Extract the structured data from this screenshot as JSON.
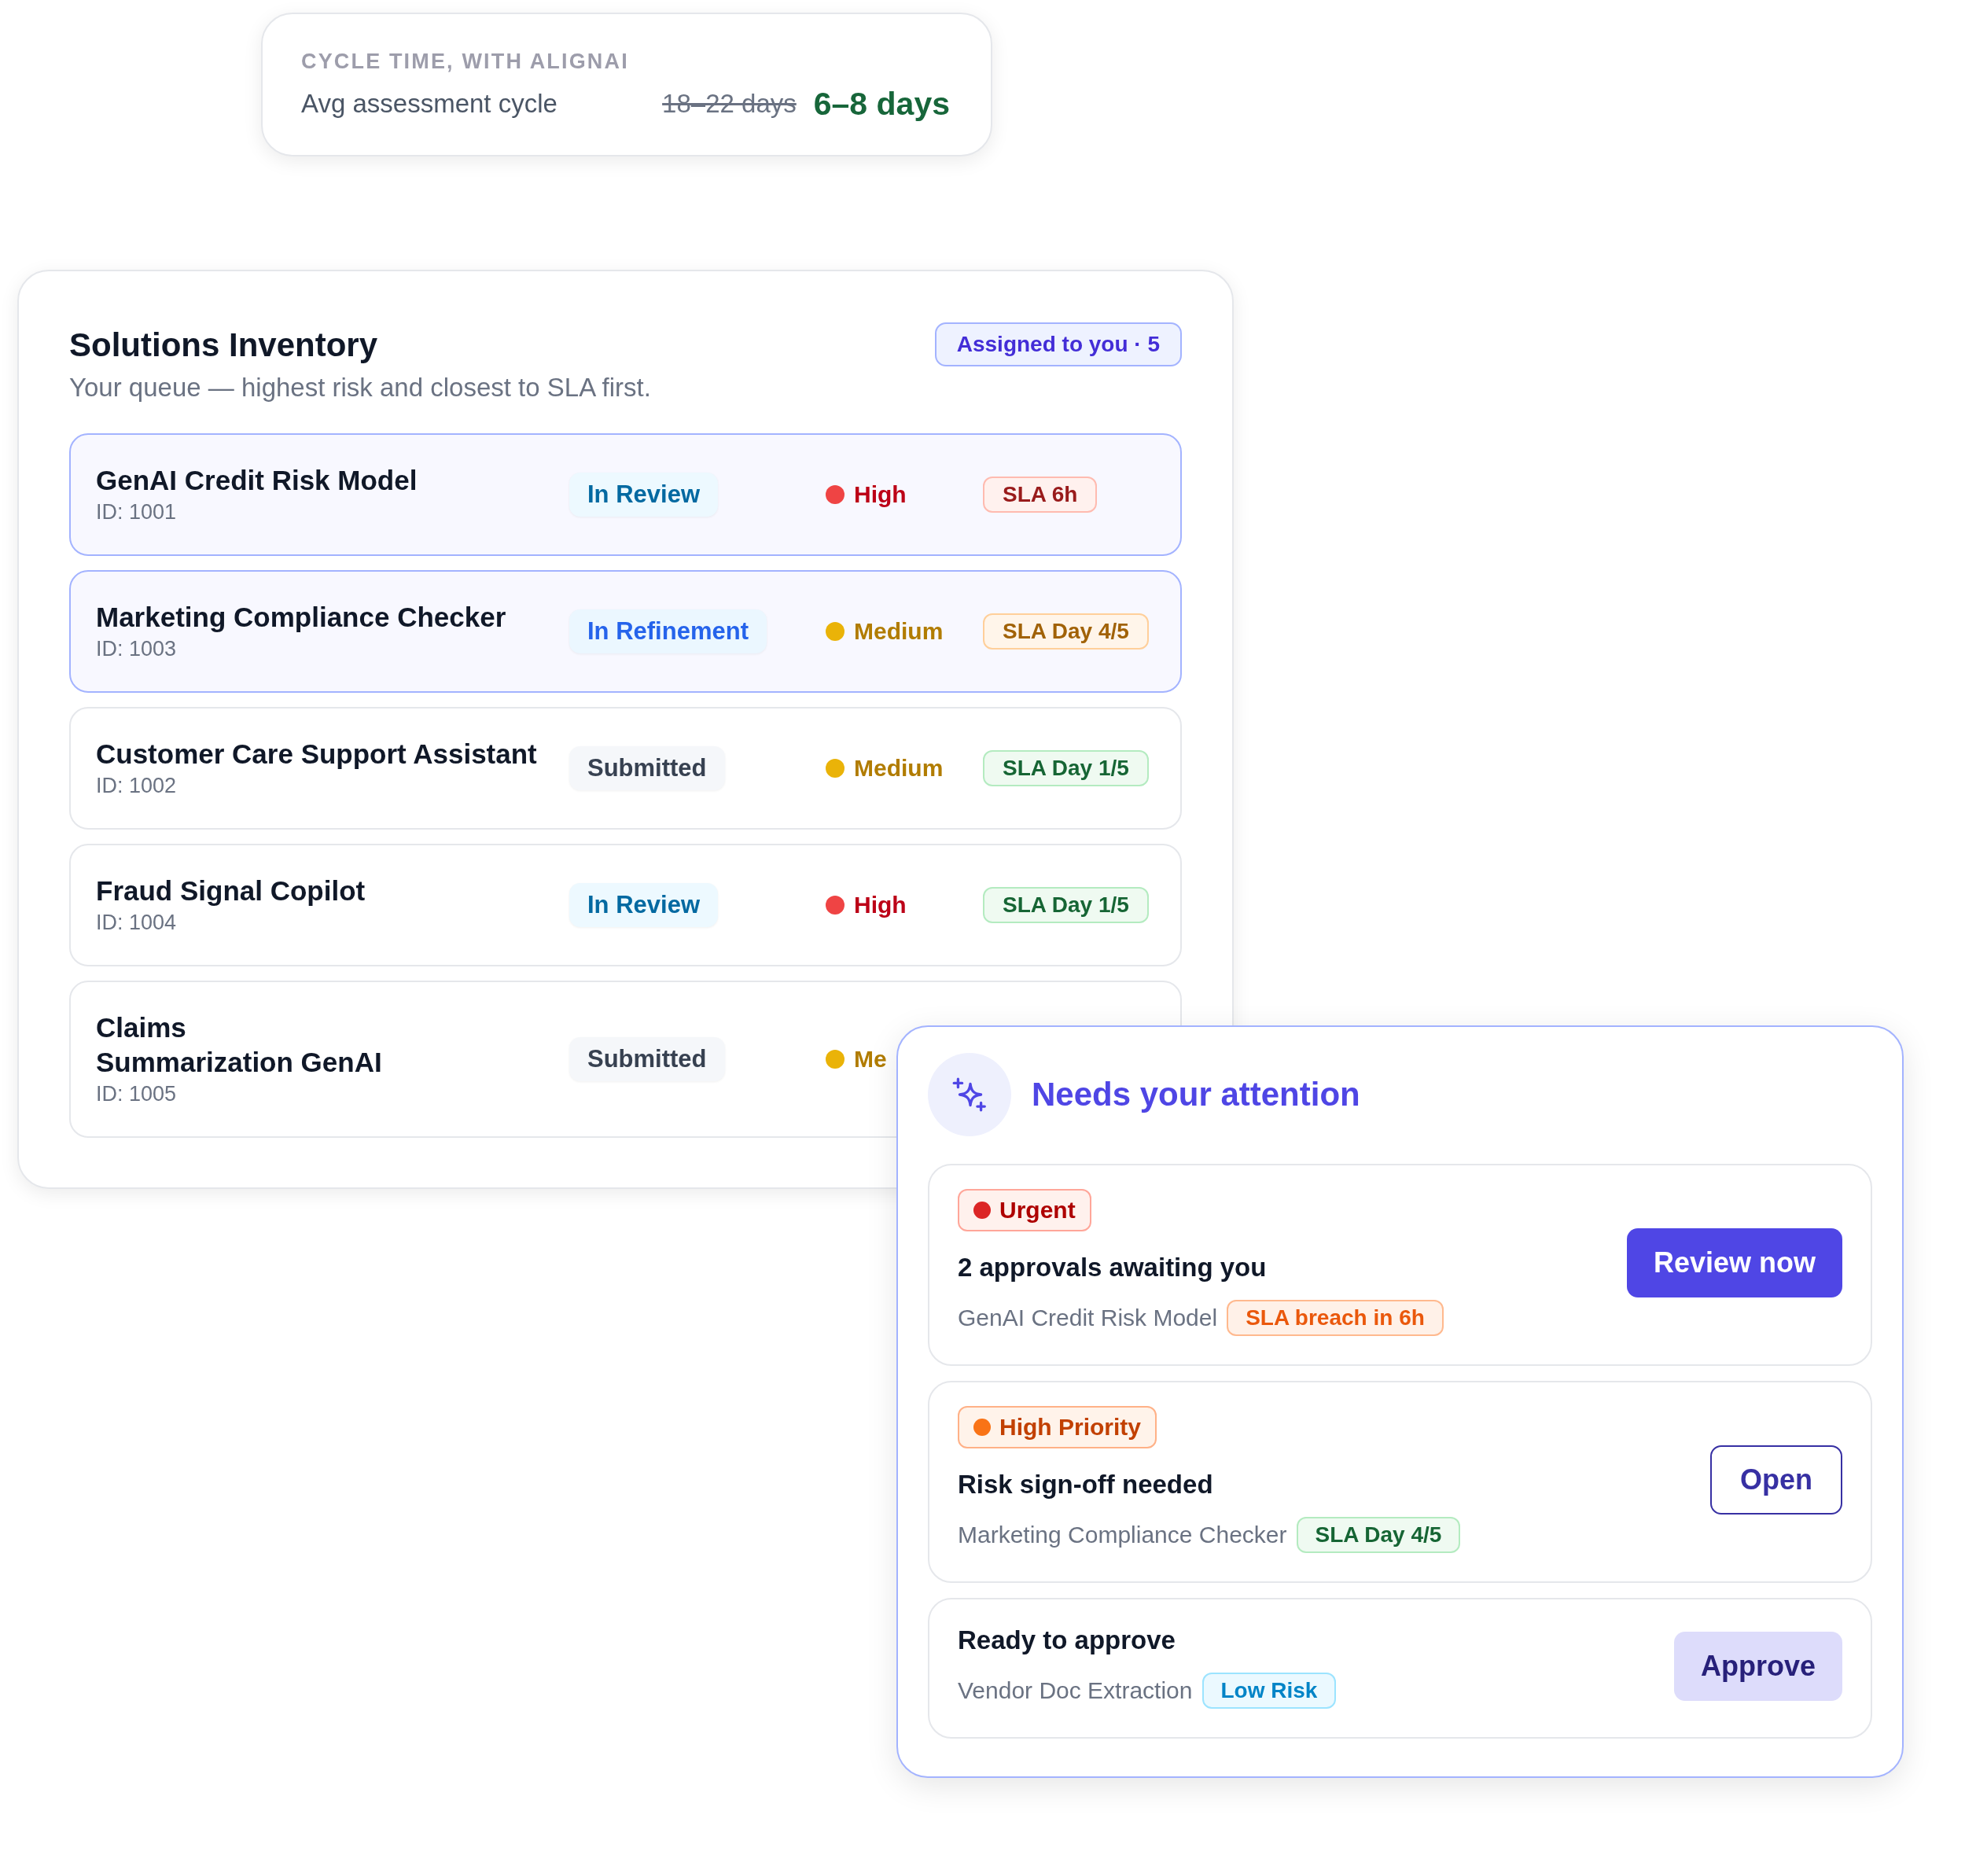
{
  "cycle_card": {
    "label": "CYCLE TIME, WITH ALIGNAI",
    "metric": "Avg assessment cycle",
    "before": "18–22 days",
    "after": "6–8 days"
  },
  "inventory": {
    "title": "Solutions Inventory",
    "subtitle": "Your queue — highest risk and closest to SLA first.",
    "assigned": "Assigned to you · 5",
    "rows": [
      {
        "name": "GenAI Credit Risk Model",
        "id": "ID: 1001",
        "selected": true,
        "status": {
          "label": "In Review",
          "color": "#0369a1"
        },
        "risk": {
          "label": "High",
          "color": "#ef4444"
        },
        "sla": {
          "label": "SLA 6h",
          "color": "#991b1b"
        }
      },
      {
        "name": "Marketing Compliance Checker",
        "id": "ID: 1003",
        "selected": true,
        "status": {
          "label": "In Refinement",
          "color": "#2563eb"
        },
        "risk": {
          "label": "Medium",
          "color": "#eab308"
        },
        "sla": {
          "label": "SLA Day 4/5",
          "color": "#a16207"
        }
      },
      {
        "name": "Customer Care Support Assistant",
        "id": "ID: 1002",
        "selected": false,
        "status": {
          "label": "Submitted",
          "color": "#374151"
        },
        "risk": {
          "label": "Medium",
          "color": "#eab308"
        },
        "sla": {
          "label": "SLA Day 1/5",
          "color": "#166534"
        }
      },
      {
        "name": "Fraud Signal Copilot",
        "id": "ID: 1004",
        "selected": false,
        "status": {
          "label": "In Review",
          "color": "#0369a1"
        },
        "risk": {
          "label": "High",
          "color": "#ef4444"
        },
        "sla": {
          "label": "SLA Day 1/5",
          "color": "#166534"
        }
      },
      {
        "name": "Claims\nSummarization GenAI",
        "id": "ID: 1005",
        "selected": false,
        "status": {
          "label": "Submitted",
          "color": "#374151"
        },
        "risk": {
          "label": "Me",
          "color": "#eab308"
        }
      }
    ]
  },
  "attention": {
    "title": "Needs your attention",
    "items": [
      {
        "priority": {
          "label": "Urgent",
          "color": "#dc2626"
        },
        "title": "2 approvals awaiting you",
        "subject": "GenAI Credit Risk Model",
        "tag": {
          "label": "SLA breach in 6h",
          "color": "#ea580c"
        },
        "action": {
          "label": "Review now",
          "kind": "primary"
        }
      },
      {
        "priority": {
          "label": "High Priority",
          "color": "#f97316"
        },
        "title": "Risk sign-off needed",
        "subject": "Marketing Compliance Checker",
        "tag": {
          "label": "SLA Day 4/5",
          "color": "#166534"
        },
        "action": {
          "label": "Open",
          "kind": "outline"
        }
      },
      {
        "title": "Ready to approve",
        "subject": "Vendor Doc Extraction",
        "tag": {
          "label": "Low Risk",
          "color": "#0284c7"
        },
        "action": {
          "label": "Approve",
          "kind": "soft"
        }
      }
    ]
  }
}
